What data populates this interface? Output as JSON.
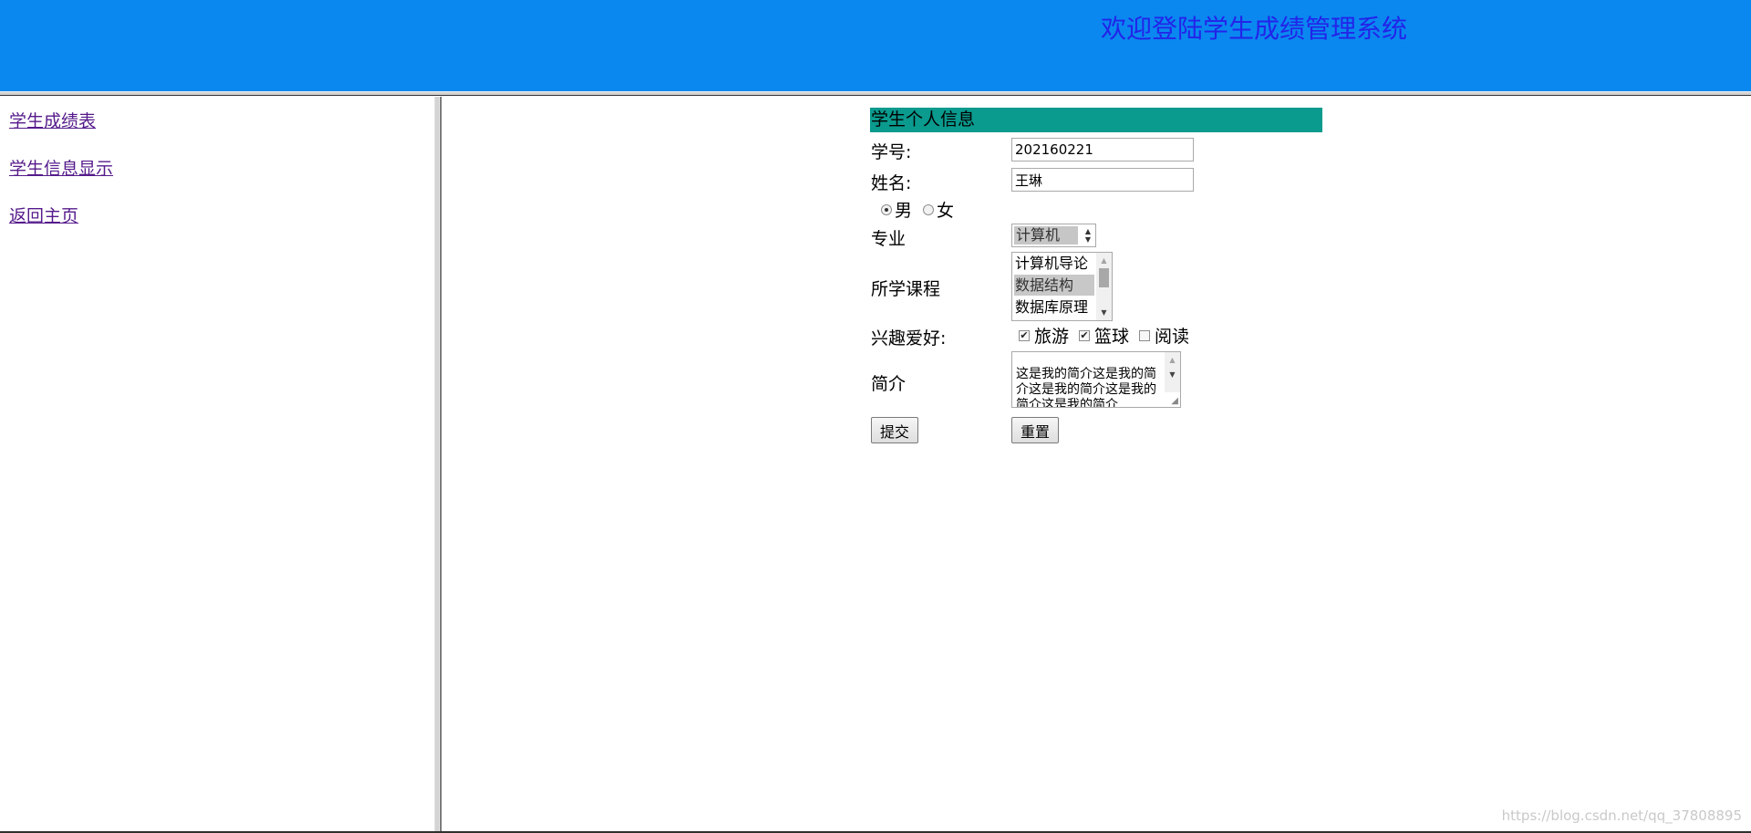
{
  "header": {
    "title": "欢迎登陆学生成绩管理系统"
  },
  "sidebar": {
    "links": [
      {
        "label": "学生成绩表"
      },
      {
        "label": "学生信息显示"
      },
      {
        "label": "返回主页"
      }
    ]
  },
  "form": {
    "title": "学生个人信息",
    "student_id": {
      "label": "学号:",
      "value": "202160221"
    },
    "name": {
      "label": "姓名:",
      "value": "王琳"
    },
    "gender": {
      "options": [
        {
          "label": "男",
          "checked": true
        },
        {
          "label": "女",
          "checked": false
        }
      ]
    },
    "major": {
      "label": "专业",
      "selected": "计算机"
    },
    "courses": {
      "label": "所学课程",
      "options": [
        {
          "label": "计算机导论",
          "selected": false
        },
        {
          "label": "数据结构",
          "selected": true
        },
        {
          "label": "数据库原理",
          "selected": false
        }
      ]
    },
    "hobbies": {
      "label": "兴趣爱好:",
      "options": [
        {
          "label": "旅游",
          "checked": true
        },
        {
          "label": "篮球",
          "checked": true
        },
        {
          "label": "阅读",
          "checked": false
        }
      ]
    },
    "intro": {
      "label": "简介",
      "value": "这是我的简介这是我的简介这是我的简介这是我的简介这是我的简介"
    },
    "submit_label": "提交",
    "reset_label": "重置"
  },
  "watermark": "https://blog.csdn.net/qq_37808895",
  "colors": {
    "header_bg": "#0a88f0",
    "header_title": "#2323e8",
    "form_title_bg": "#0b9a8e",
    "link_visited": "#551a8b"
  }
}
